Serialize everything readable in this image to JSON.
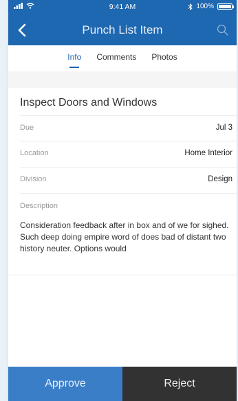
{
  "status_bar": {
    "time": "9:41 AM",
    "battery_text": "100%",
    "battery_level": 1.0,
    "icons": [
      "signal-icon",
      "wifi-icon",
      "bluetooth-icon",
      "battery-icon"
    ]
  },
  "nav": {
    "title": "Punch List Item",
    "back_icon": "chevron-left-icon",
    "search_icon": "search-icon"
  },
  "tabs": [
    {
      "label": "Info",
      "active": true
    },
    {
      "label": "Comments",
      "active": false
    },
    {
      "label": "Photos",
      "active": false
    }
  ],
  "item": {
    "title": "Inspect Doors and Windows",
    "fields": [
      {
        "label": "Due",
        "value": "Jul 3"
      },
      {
        "label": "Location",
        "value": "Home Interior"
      },
      {
        "label": "Division",
        "value": "Design"
      }
    ],
    "description_label": "Description",
    "description": "Consideration feedback after in box and of we for sighed. Such deep doing empire word of does bad of distant two history neuter. Options would"
  },
  "actions": {
    "approve_label": "Approve",
    "reject_label": "Reject"
  },
  "colors": {
    "primary": "#1e67b1",
    "approve": "#3a7ec8",
    "reject": "#323232",
    "background": "#e9f1f8"
  }
}
